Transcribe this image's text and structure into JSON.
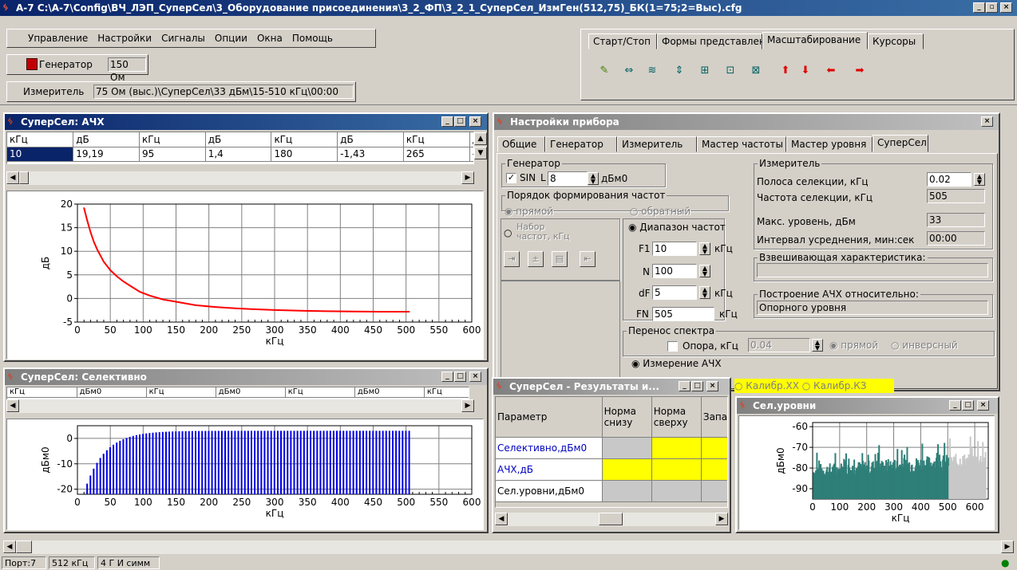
{
  "app": {
    "title": "А-7  C:\\А-7\\Config\\ВЧ_ЛЭП_СуперСел\\3_Оборудование присоединения\\3_2_ФП\\3_2_1_СуперСел_ИзмГен(512,75)_БК(1=75;2=Выс).cfg",
    "menu": [
      "Управление",
      "Настройки",
      "Сигналы",
      "Опции",
      "Окна",
      "Помощь"
    ],
    "generator_label": "Генератор",
    "generator_value": "150 Ом",
    "meter_label": "Измеритель",
    "meter_value": "75 Ом (выс.)\\СуперСел\\33 дБм\\15-510 кГц\\00:00"
  },
  "toolbar_tabs": [
    "Старт/Стоп",
    "Формы представления",
    "Масштабирование",
    "Курсоры"
  ],
  "toolbar_icons": [
    "brush-icon",
    "fit-horizontal-icon",
    "zoom-waves-icon",
    "fit-vertical-icon",
    "fit-xy-icon",
    "fit-all-icon",
    "fit-grid-icon",
    "arrow-up-icon",
    "arrow-down-icon",
    "arrow-left-icon",
    "arrow-right-icon"
  ],
  "afc_window": {
    "title": "СуперСел: АЧХ",
    "headers": [
      "кГц",
      "дБ",
      "кГц",
      "дБ",
      "кГц",
      "дБ",
      "кГц",
      "д"
    ],
    "row": [
      "10",
      "19,19",
      "95",
      "1,4",
      "180",
      "-1,43",
      "265",
      "-"
    ]
  },
  "selective_window": {
    "title": "СуперСел: Селективно",
    "headers": [
      "кГц",
      "дБм0",
      "кГц",
      "дБм0",
      "кГц",
      "дБм0",
      "кГц"
    ]
  },
  "results_window": {
    "title": "СуперСел - Результаты и...",
    "headers": [
      "Параметр",
      "Норма снизу",
      "Норма сверху",
      "Запас"
    ],
    "rows": [
      "Селективно,дБм0",
      "АЧХ,дБ",
      "Сел.уровни,дБм0"
    ]
  },
  "levels_window": {
    "title": "Сел.уровни"
  },
  "calib": [
    "Калибр.XX",
    "Калибр.КЗ"
  ],
  "settings": {
    "title": "Настройки прибора",
    "tabs": [
      "Общие",
      "Генератор",
      "Измеритель",
      "Мастер частоты",
      "Мастер уровня",
      "СуперСел"
    ],
    "gen_group": "Генератор",
    "sin_label": "SIN",
    "l_label": "L",
    "l_value": "8",
    "l_unit": "дБм0",
    "order_group": "Порядок формирования частот",
    "order_direct": "прямой",
    "order_reverse": "обратный",
    "set_label": "Набор частот, кГц",
    "range_label": "Диапазон частот",
    "f1_label": "F1",
    "f1_value": "10",
    "f1_unit": "кГц",
    "n_label": "N",
    "n_value": "100",
    "df_label": "dF",
    "df_value": "5",
    "df_unit": "кГц",
    "fn_label": "FN",
    "fn_value": "505",
    "fn_unit": "кГц",
    "spectrum_group": "Перенос спектра",
    "ref_label": "Опора, кГц",
    "ref_value": "0.04",
    "spec_direct": "прямой",
    "spec_inverse": "инверсный",
    "measure_afc": "Измерение АЧХ",
    "meter_group": "Измеритель",
    "sel_band_label": "Полоса селекции, кГц",
    "sel_band_value": "0.02",
    "sel_freq_label": "Частота селекции, кГц",
    "sel_freq_value": "505",
    "max_level_label": "Макс. уровень, дБм",
    "max_level_value": "33",
    "avg_label": "Интервал усреднения, мин:сек",
    "avg_value": "00:00",
    "weight_group": "Взвешивающая характеристика:",
    "build_group": "Построение АЧХ относительно:",
    "build_value": "Опорного уровня"
  },
  "status": [
    "Порт:7",
    "512 кГц",
    "4 Г И симм"
  ],
  "chart_data": [
    {
      "type": "line",
      "ylabel": "дБ",
      "xlabel": "кГц",
      "xlim": [
        0,
        600
      ],
      "ylim": [
        -5,
        20
      ],
      "xticks": [
        0,
        50,
        100,
        150,
        200,
        250,
        300,
        350,
        400,
        450,
        500,
        550,
        600
      ],
      "yticks": [
        20,
        15,
        10,
        5,
        0,
        -5
      ],
      "color": "#ff0000",
      "x": [
        10,
        15,
        20,
        25,
        30,
        40,
        50,
        60,
        70,
        80,
        95,
        110,
        130,
        150,
        180,
        210,
        240,
        265,
        300,
        340,
        380,
        420,
        460,
        505
      ],
      "y": [
        19.19,
        16.5,
        14.0,
        12.0,
        10.4,
        7.8,
        6.0,
        4.7,
        3.6,
        2.7,
        1.4,
        0.6,
        -0.2,
        -0.7,
        -1.43,
        -1.8,
        -2.1,
        -2.25,
        -2.45,
        -2.6,
        -2.7,
        -2.75,
        -2.8,
        -2.8
      ]
    },
    {
      "type": "bar",
      "ylabel": "дБм0",
      "xlabel": "кГц",
      "xlim": [
        0,
        600
      ],
      "ylim": [
        -22,
        5
      ],
      "xticks": [
        0,
        50,
        100,
        150,
        200,
        250,
        300,
        350,
        400,
        450,
        500,
        550,
        600
      ],
      "yticks": [
        0,
        -10,
        -20
      ],
      "color": "#0000e0",
      "x_start": 10,
      "x_step": 5,
      "count": 100,
      "curve": "rise from -20 at 15 kHz to about +3 from 150 kHz"
    },
    {
      "type": "area",
      "ylabel": "дБм0",
      "xlabel": "кГц",
      "xlim": [
        0,
        650
      ],
      "ylim": [
        -95,
        -58
      ],
      "xticks": [
        0,
        100,
        200,
        300,
        400,
        500,
        600
      ],
      "yticks": [
        -60,
        -70,
        -80,
        -90
      ],
      "colors": [
        "#2f7f78",
        "#c8c8c8"
      ],
      "split_x": 505
    }
  ]
}
